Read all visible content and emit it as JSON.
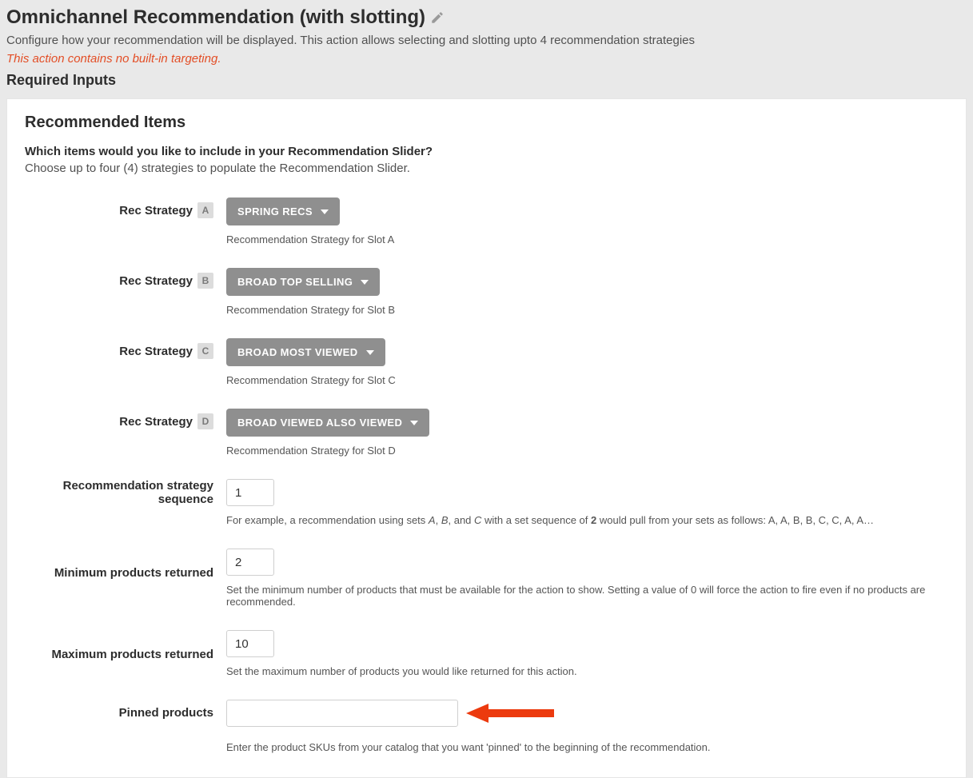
{
  "header": {
    "title": "Omnichannel Recommendation (with slotting)",
    "subtitle": "Configure how your recommendation will be displayed. This action allows selecting and slotting upto 4 recommendation strategies",
    "warning": "This action contains no built-in targeting.",
    "required_inputs": "Required Inputs"
  },
  "panel": {
    "heading": "Recommended Items",
    "question": "Which items would you like to include in your Recommendation Slider?",
    "instruction": "Choose up to four (4) strategies to populate the Recommendation Slider."
  },
  "slots": {
    "a": {
      "label": "Rec Strategy",
      "letter": "A",
      "value": "SPRING RECS",
      "help": "Recommendation Strategy for Slot A"
    },
    "b": {
      "label": "Rec Strategy",
      "letter": "B",
      "value": "BROAD TOP SELLING",
      "help": "Recommendation Strategy for Slot B"
    },
    "c": {
      "label": "Rec Strategy",
      "letter": "C",
      "value": "BROAD MOST VIEWED",
      "help": "Recommendation Strategy for Slot C"
    },
    "d": {
      "label": "Rec Strategy",
      "letter": "D",
      "value": "BROAD VIEWED ALSO VIEWED",
      "help": "Recommendation Strategy for Slot D"
    }
  },
  "sequence": {
    "label": "Recommendation strategy sequence",
    "value": "1",
    "help_prefix": "For example, a recommendation using sets ",
    "help_em1": "A",
    "help_mid1": ", ",
    "help_em2": "B",
    "help_mid2": ", and ",
    "help_em3": "C",
    "help_mid3": " with a set sequence of ",
    "help_strong": "2",
    "help_suffix": " would pull from your sets as follows: A, A, B, B, C, C, A, A…"
  },
  "min": {
    "label": "Minimum products returned",
    "value": "2",
    "help": "Set the minimum number of products that must be available for the action to show. Setting a value of 0 will force the action to fire even if no products are recommended."
  },
  "max": {
    "label": "Maximum products returned",
    "value": "10",
    "help": "Set the maximum number of products you would like returned for this action."
  },
  "pinned": {
    "label": "Pinned products",
    "value": "",
    "help": "Enter the product SKUs from your catalog that you want 'pinned' to the beginning of the recommendation."
  },
  "colors": {
    "arrow": "#ec3a0e"
  }
}
